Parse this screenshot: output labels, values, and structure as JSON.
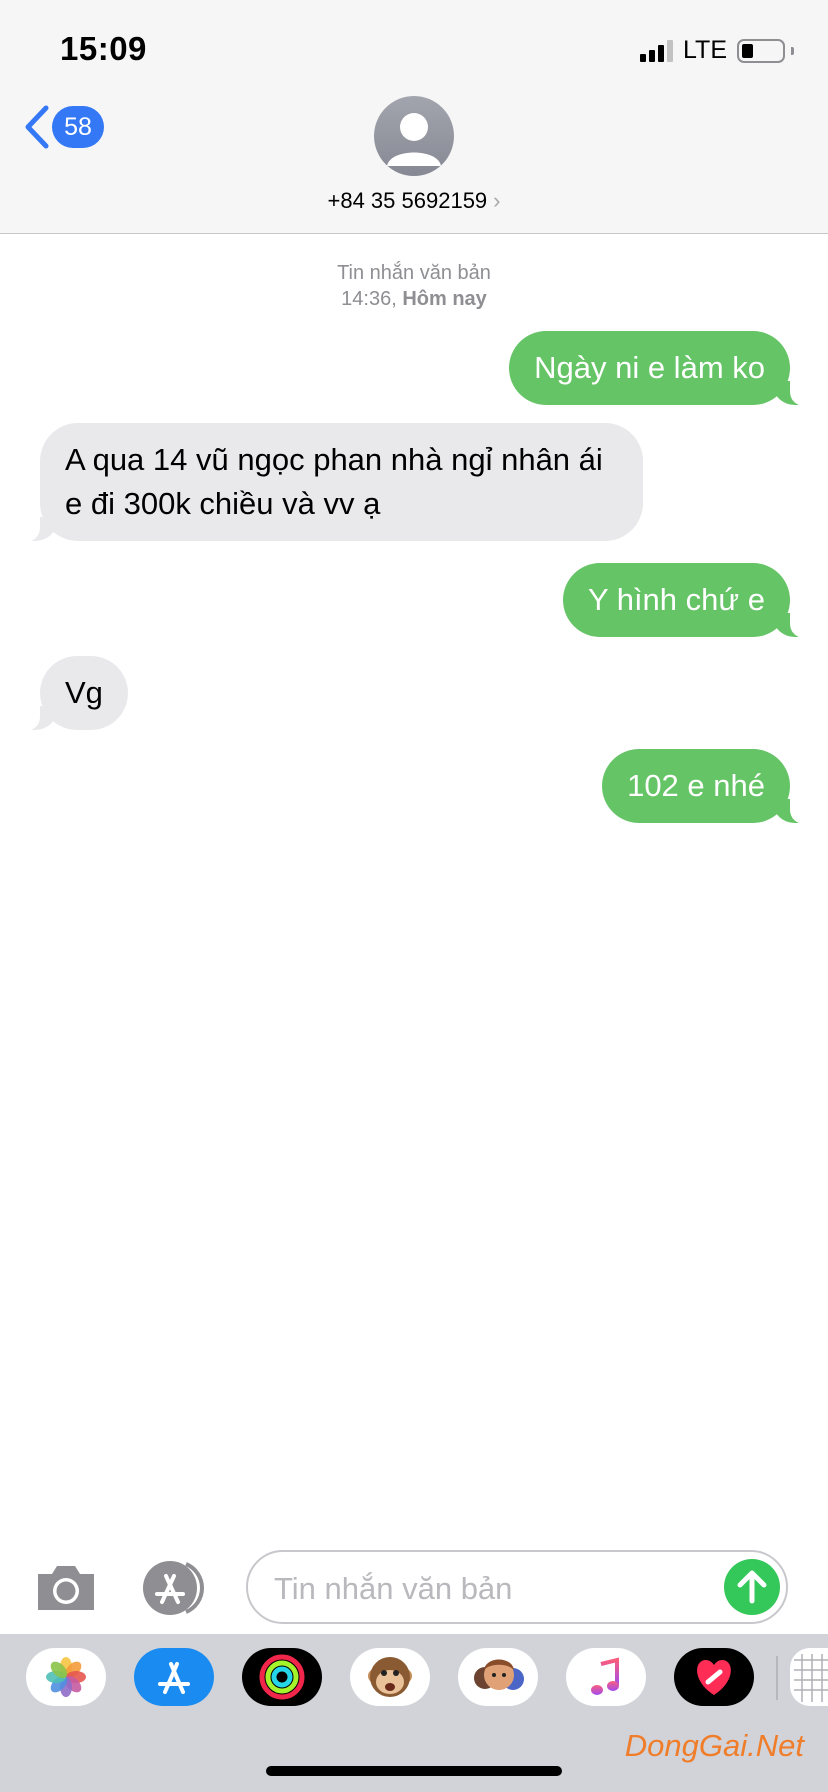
{
  "status_bar": {
    "time": "15:09",
    "carrier": "LTE",
    "signal_bars": 3,
    "battery_level": 0.2
  },
  "header": {
    "back_count": "58",
    "contact": "+84 35 5692159",
    "contact_chevron": "›"
  },
  "conversation": {
    "label": "Tin nhắn văn bản",
    "time": "14:36,",
    "day": "Hôm nay",
    "messages": [
      {
        "direction": "sent",
        "text": "Ngày ni e làm ko"
      },
      {
        "direction": "received",
        "text": "A qua 14 vũ ngọc phan nhà ngỉ nhân ái e đi 300k chiều và vv ạ"
      },
      {
        "direction": "sent",
        "text": "Y hình chứ e"
      },
      {
        "direction": "received",
        "text": "Vg"
      },
      {
        "direction": "sent",
        "text": "102 e nhé"
      }
    ]
  },
  "input": {
    "placeholder": "Tin nhắn văn bản"
  },
  "drawer": {
    "apps": [
      "photos-icon",
      "app-store-icon",
      "activity-icon",
      "animoji-icon",
      "memoji-icon",
      "music-icon",
      "digital-touch-icon",
      "more-icon"
    ]
  },
  "watermark": "DongGai.Net",
  "colors": {
    "sent_bubble": "#65c466",
    "received_bubble": "#e9e9eb",
    "accent": "#3478f6",
    "send_button": "#34c759",
    "watermark": "#f07d2a"
  }
}
